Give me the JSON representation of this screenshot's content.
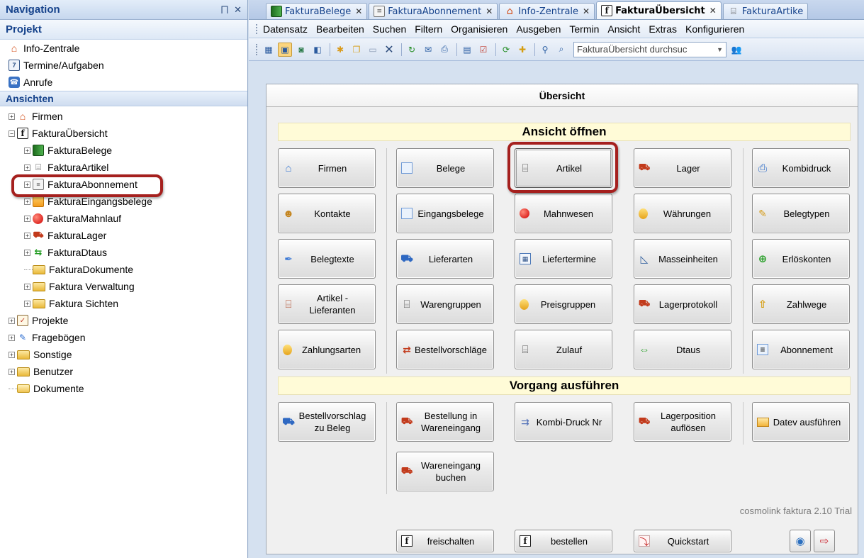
{
  "nav": {
    "header_title": "Navigation",
    "pin_glyph": "⨅",
    "close_glyph": "✕",
    "section_projekt": "Projekt",
    "projekt_items": [
      {
        "label": "Info-Zentrale",
        "icon": "home-icon"
      },
      {
        "label": "Termine/Aufgaben",
        "icon": "calendar-icon"
      },
      {
        "label": "Anrufe",
        "icon": "phone-icon"
      }
    ],
    "section_ansichten": "Ansichten",
    "tree": [
      {
        "label": "Firmen",
        "icon": "home-icon",
        "level": 0,
        "expander": "+"
      },
      {
        "label": "FakturaÜbersicht",
        "icon": "faktura-icon",
        "level": 0,
        "expander": "-"
      },
      {
        "label": "FakturaBelege",
        "icon": "book-icon",
        "level": 1,
        "expander": "+"
      },
      {
        "label": "FakturaArtikel",
        "icon": "cart-icon",
        "level": 1,
        "expander": "+"
      },
      {
        "label": "FakturaAbonnement",
        "icon": "document-icon",
        "level": 1,
        "expander": "+"
      },
      {
        "label": "FakturaEingangsbelege",
        "icon": "stack-icon",
        "level": 1,
        "expander": "+"
      },
      {
        "label": "FakturaMahnlauf",
        "icon": "red-dot-icon",
        "level": 1,
        "expander": "+"
      },
      {
        "label": "FakturaLager",
        "icon": "pallet-icon",
        "level": 1,
        "expander": "+"
      },
      {
        "label": "FakturaDtaus",
        "icon": "arrows-icon",
        "level": 1,
        "expander": "+"
      },
      {
        "label": "FakturaDokumente",
        "icon": "folder-icon",
        "level": 1,
        "expander": ""
      },
      {
        "label": "Faktura Verwaltung",
        "icon": "folder-icon",
        "level": 1,
        "expander": "+"
      },
      {
        "label": "Faktura Sichten",
        "icon": "folder-icon",
        "level": 1,
        "expander": "+"
      },
      {
        "label": "Projekte",
        "icon": "checklist-icon",
        "level": 0,
        "expander": "+"
      },
      {
        "label": "Fragebögen",
        "icon": "pencil-icon",
        "level": 0,
        "expander": "+"
      },
      {
        "label": "Sonstige",
        "icon": "folder-icon",
        "level": 0,
        "expander": "+"
      },
      {
        "label": "Benutzer",
        "icon": "folder-icon",
        "level": 0,
        "expander": "+"
      },
      {
        "label": "Dokumente",
        "icon": "open-folder-icon",
        "level": 0,
        "expander": ""
      }
    ]
  },
  "tabs": [
    {
      "label": "FakturaBelege",
      "icon": "book-icon",
      "active": false
    },
    {
      "label": "FakturaAbonnement",
      "icon": "document-icon",
      "active": false
    },
    {
      "label": "Info-Zentrale",
      "icon": "home-icon",
      "active": false
    },
    {
      "label": "FakturaÜbersicht",
      "icon": "faktura-icon",
      "active": true
    },
    {
      "label": "FakturaArtike",
      "icon": "cart-icon",
      "active": false
    }
  ],
  "tab_close_glyph": "✕",
  "menu": [
    "Datensatz",
    "Bearbeiten",
    "Suchen",
    "Filtern",
    "Organisieren",
    "Ausgeben",
    "Termin",
    "Ansicht",
    "Extras",
    "Konfigurieren"
  ],
  "toolbar": {
    "search_placeholder": "FakturaÜbersicht durchsuc",
    "dropdown_glyph": "▼"
  },
  "panel": {
    "title": "Übersicht",
    "group_open": "Ansicht öffnen",
    "group_run": "Vorgang ausführen",
    "brand": "cosmolink faktura 2.10 Trial"
  },
  "open_buttons": [
    {
      "label": "Firmen",
      "icon": "home-icon"
    },
    {
      "label": "Belege",
      "icon": "pages-icon"
    },
    {
      "label": "Artikel",
      "icon": "cart-icon",
      "selected": true
    },
    {
      "label": "Lager",
      "icon": "pallet-icon"
    },
    {
      "label": "Kombidruck",
      "icon": "printer-icon"
    },
    {
      "label": "Kontakte",
      "icon": "people-icon"
    },
    {
      "label": "Eingangsbelege",
      "icon": "pages-icon"
    },
    {
      "label": "Mahnwesen",
      "icon": "red-dot-icon"
    },
    {
      "label": "Währungen",
      "icon": "coins-icon"
    },
    {
      "label": "Belegtypen",
      "icon": "note-icon"
    },
    {
      "label": "Belegtexte",
      "icon": "pen-icon"
    },
    {
      "label": "Lieferarten",
      "icon": "truck-icon"
    },
    {
      "label": "Liefertermine",
      "icon": "calendar-icon"
    },
    {
      "label": "Masseinheiten",
      "icon": "ruler-icon"
    },
    {
      "label": "Erlöskonten",
      "icon": "green-plus-icon"
    },
    {
      "label": "Artikel - Lieferanten",
      "icon": "cart-color-icon"
    },
    {
      "label": "Warengruppen",
      "icon": "cart-icon"
    },
    {
      "label": "Preisgruppen",
      "icon": "coins-icon"
    },
    {
      "label": "Lagerprotokoll",
      "icon": "pallet-icon"
    },
    {
      "label": "Zahlwege",
      "icon": "yellow-arrow-icon"
    },
    {
      "label": "Zahlungsarten",
      "icon": "coins-icon"
    },
    {
      "label": "Bestellvorschläge",
      "icon": "cycle-icon"
    },
    {
      "label": "Zulauf",
      "icon": "cart-icon"
    },
    {
      "label": "Dtaus",
      "icon": "arrows-icon"
    },
    {
      "label": "Abonnement",
      "icon": "document-icon"
    }
  ],
  "run_buttons": [
    {
      "label": "Bestellvorschlag zu Beleg",
      "icon": "truck-icon"
    },
    {
      "label": "Bestellung in Wareneingang",
      "icon": "pallet-icon"
    },
    {
      "label": "Kombi-Druck Nr",
      "icon": "kombi-icon"
    },
    {
      "label": "Lagerposition auflösen",
      "icon": "pallet-icon"
    },
    {
      "label": "Datev ausführen",
      "icon": "datev-icon"
    },
    {
      "label": "Wareneingang buchen",
      "icon": "pallet-icon"
    }
  ],
  "footer_buttons": [
    {
      "label": "freischalten",
      "icon": "faktura-icon"
    },
    {
      "label": "bestellen",
      "icon": "faktura-icon"
    },
    {
      "label": "Quickstart",
      "icon": "pdf-icon"
    }
  ]
}
